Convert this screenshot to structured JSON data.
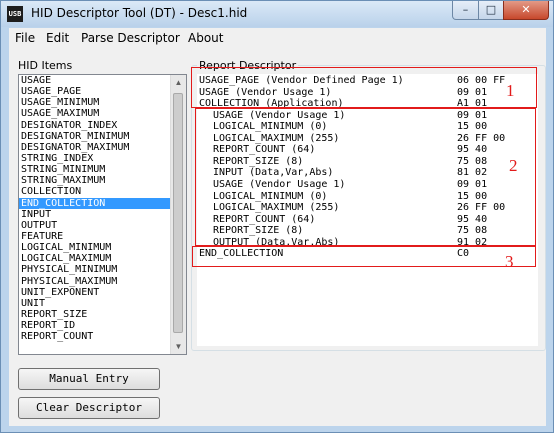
{
  "window": {
    "title": "HID Descriptor Tool (DT) - Desc1.hid",
    "app_icon_text": "USB",
    "minimize_glyph": "–",
    "maximize_glyph": "□",
    "close_glyph": "✕"
  },
  "menu": [
    "File",
    "Edit",
    "Parse Descriptor",
    "About"
  ],
  "hid_items": {
    "label": "HID Items",
    "selected_index": 11,
    "items": [
      "USAGE",
      "USAGE_PAGE",
      "USAGE_MINIMUM",
      "USAGE_MAXIMUM",
      "DESIGNATOR_INDEX",
      "DESIGNATOR_MINIMUM",
      "DESIGNATOR_MAXIMUM",
      "STRING_INDEX",
      "STRING_MINIMUM",
      "STRING_MAXIMUM",
      "COLLECTION",
      "END_COLLECTION",
      "INPUT",
      "OUTPUT",
      "FEATURE",
      "LOGICAL_MINIMUM",
      "LOGICAL_MAXIMUM",
      "PHYSICAL_MINIMUM",
      "PHYSICAL_MAXIMUM",
      "UNIT_EXPONENT",
      "UNIT",
      "REPORT_SIZE",
      "REPORT_ID",
      "REPORT_COUNT"
    ]
  },
  "buttons": {
    "manual_entry": "Manual Entry",
    "clear_descriptor": "Clear Descriptor"
  },
  "report_descriptor": {
    "label": "Report Descriptor",
    "rows": [
      {
        "item": "USAGE_PAGE (Vendor Defined Page 1)",
        "bytes": "06 00 FF",
        "indent": false
      },
      {
        "item": "USAGE (Vendor Usage 1)",
        "bytes": "09 01",
        "indent": false
      },
      {
        "item": "COLLECTION (Application)",
        "bytes": "A1 01",
        "indent": false
      },
      {
        "item": "USAGE (Vendor Usage 1)",
        "bytes": "09 01",
        "indent": true
      },
      {
        "item": "LOGICAL_MINIMUM (0)",
        "bytes": "15 00",
        "indent": true
      },
      {
        "item": "LOGICAL_MAXIMUM (255)",
        "bytes": "26 FF 00",
        "indent": true
      },
      {
        "item": "REPORT_COUNT (64)",
        "bytes": "95 40",
        "indent": true
      },
      {
        "item": "REPORT_SIZE (8)",
        "bytes": "75 08",
        "indent": true
      },
      {
        "item": "INPUT (Data,Var,Abs)",
        "bytes": "81 02",
        "indent": true
      },
      {
        "item": "USAGE (Vendor Usage 1)",
        "bytes": "09 01",
        "indent": true
      },
      {
        "item": "LOGICAL_MINIMUM (0)",
        "bytes": "15 00",
        "indent": true
      },
      {
        "item": "LOGICAL_MAXIMUM (255)",
        "bytes": "26 FF 00",
        "indent": true
      },
      {
        "item": "REPORT_COUNT (64)",
        "bytes": "95 40",
        "indent": true
      },
      {
        "item": "REPORT_SIZE (8)",
        "bytes": "75 08",
        "indent": true
      },
      {
        "item": "OUTPUT (Data,Var,Abs)",
        "bytes": "91 02",
        "indent": true
      },
      {
        "item": "END_COLLECTION",
        "bytes": "C0",
        "indent": false
      }
    ]
  },
  "annotations": [
    "1",
    "2",
    "3"
  ],
  "annotation_color": "#e21b1b",
  "selection_color": "#3399ff"
}
